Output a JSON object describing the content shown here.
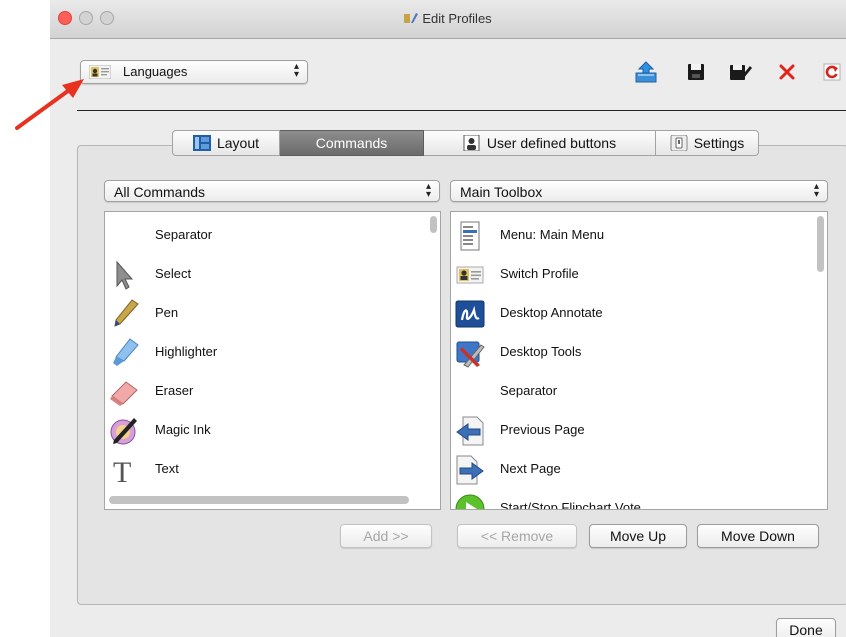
{
  "window": {
    "title": "Edit Profiles"
  },
  "profile_select": {
    "value": "Languages",
    "icon": "profile-icon"
  },
  "toolbar": {
    "icons": [
      "upload-profile-icon",
      "save-icon",
      "edit-save-icon",
      "delete-icon",
      "refresh-icon"
    ]
  },
  "tabs": [
    {
      "label": "Layout",
      "icon": "layout-icon",
      "active": false
    },
    {
      "label": "Commands",
      "active": true
    },
    {
      "label": "User defined buttons",
      "icon": "user-icon",
      "active": false
    },
    {
      "label": "Settings",
      "icon": "settings-icon",
      "active": false
    }
  ],
  "left_filter": {
    "value": "All Commands"
  },
  "right_filter": {
    "value": "Main Toolbox"
  },
  "left_list": [
    {
      "label": "Separator",
      "icon": null
    },
    {
      "label": "Select",
      "icon": "select-arrow-icon"
    },
    {
      "label": "Pen",
      "icon": "pen-icon"
    },
    {
      "label": "Highlighter",
      "icon": "highlighter-icon"
    },
    {
      "label": "Eraser",
      "icon": "eraser-icon"
    },
    {
      "label": "Magic Ink",
      "icon": "magic-ink-icon"
    },
    {
      "label": "Text",
      "icon": "text-icon"
    }
  ],
  "right_list": [
    {
      "label": "Menu: Main Menu",
      "icon": "menu-icon"
    },
    {
      "label": "Switch Profile",
      "icon": "profile-icon"
    },
    {
      "label": "Desktop Annotate",
      "icon": "desktop-annotate-icon"
    },
    {
      "label": "Desktop Tools",
      "icon": "desktop-tools-icon"
    },
    {
      "label": "Separator",
      "icon": null
    },
    {
      "label": "Previous Page",
      "icon": "previous-page-icon"
    },
    {
      "label": "Next Page",
      "icon": "next-page-icon"
    },
    {
      "label": "Start/Stop Flipchart Vote",
      "icon": "vote-icon"
    }
  ],
  "buttons": {
    "add": "Add >>",
    "remove": "<< Remove",
    "move_up": "Move Up",
    "move_down": "Move Down",
    "done": "Done"
  },
  "colors": {
    "close": "#ff5f57",
    "annotation_arrow": "#e8321f",
    "active_tab": "#7a7a7a"
  }
}
